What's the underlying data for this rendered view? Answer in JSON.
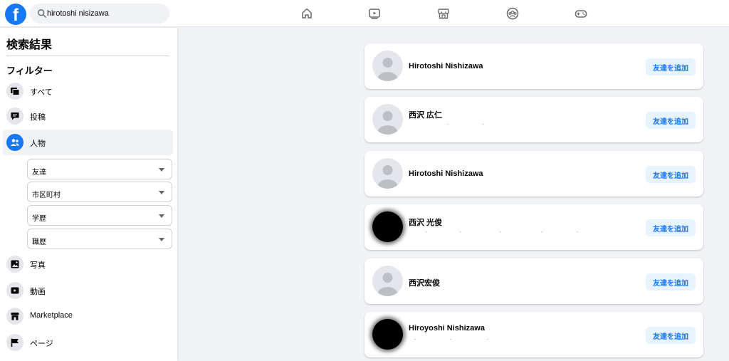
{
  "app": {
    "logo_letter": "f",
    "brand_color": "#1877f2"
  },
  "search": {
    "value": "hirotoshi nisizawa",
    "icon": "search-icon"
  },
  "nav": [
    {
      "name": "home",
      "icon": "home-icon"
    },
    {
      "name": "watch",
      "icon": "video-icon"
    },
    {
      "name": "marketplace",
      "icon": "marketplace-icon"
    },
    {
      "name": "groups",
      "icon": "groups-icon"
    },
    {
      "name": "gaming",
      "icon": "gaming-icon"
    }
  ],
  "sidebar": {
    "title": "検索結果",
    "filter_heading": "フィルター",
    "items": [
      {
        "label": "すべて",
        "icon": "all-results-icon"
      },
      {
        "label": "投稿",
        "icon": "posts-icon"
      },
      {
        "label": "人物",
        "icon": "people-icon",
        "active": true
      },
      {
        "label": "写真",
        "icon": "photos-icon"
      },
      {
        "label": "動画",
        "icon": "videos-icon"
      },
      {
        "label": "Marketplace",
        "icon": "marketplace-icon"
      },
      {
        "label": "ページ",
        "icon": "pages-icon"
      }
    ],
    "people_filters": [
      {
        "label": "友達"
      },
      {
        "label": "市区町村"
      },
      {
        "label": "学歴"
      },
      {
        "label": "職歴"
      }
    ]
  },
  "results": [
    {
      "name": "Hirotoshi Nishizawa",
      "button": "友達を追加"
    },
    {
      "name": "西沢 広仁",
      "button": "友達を追加"
    },
    {
      "name": "Hirotoshi Nishizawa",
      "button": "友達を追加"
    },
    {
      "name": "西沢 光俊",
      "button": "友達を追加"
    },
    {
      "name": "西沢宏俊",
      "button": "友達を追加"
    },
    {
      "name": "Hiroyoshi Nishizawa",
      "button": "友達を追加"
    }
  ]
}
